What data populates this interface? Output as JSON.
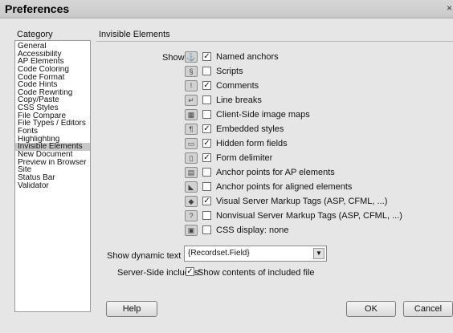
{
  "window": {
    "title": "Preferences",
    "close_glyph": "×"
  },
  "category": {
    "label": "Category",
    "items": [
      {
        "label": "General"
      },
      {
        "label": "Accessibility"
      },
      {
        "label": "AP Elements"
      },
      {
        "label": "Code Coloring"
      },
      {
        "label": "Code Format"
      },
      {
        "label": "Code Hints"
      },
      {
        "label": "Code Rewriting"
      },
      {
        "label": "Copy/Paste"
      },
      {
        "label": "CSS Styles"
      },
      {
        "label": "File Compare"
      },
      {
        "label": "File Types / Editors"
      },
      {
        "label": "Fonts"
      },
      {
        "label": "Highlighting"
      },
      {
        "label": "Invisible Elements",
        "selected": true
      },
      {
        "label": "New Document"
      },
      {
        "label": "Preview in Browser"
      },
      {
        "label": "Site"
      },
      {
        "label": "Status Bar"
      },
      {
        "label": "Validator"
      }
    ]
  },
  "section": {
    "title": "Invisible Elements",
    "show_label": "Show:",
    "options": [
      {
        "label": "Named anchors",
        "checked": true,
        "icon": "named-anchor-icon",
        "glyph": "⚓"
      },
      {
        "label": "Scripts",
        "checked": false,
        "icon": "script-icon",
        "glyph": "§"
      },
      {
        "label": "Comments",
        "checked": true,
        "icon": "comment-icon",
        "glyph": "!"
      },
      {
        "label": "Line breaks",
        "checked": false,
        "icon": "line-break-icon",
        "glyph": "↵"
      },
      {
        "label": "Client-Side image maps",
        "checked": false,
        "icon": "image-map-icon",
        "glyph": "▦"
      },
      {
        "label": "Embedded styles",
        "checked": true,
        "icon": "embedded-style-icon",
        "glyph": "¶"
      },
      {
        "label": "Hidden form fields",
        "checked": true,
        "icon": "hidden-field-icon",
        "glyph": "▭"
      },
      {
        "label": "Form delimiter",
        "checked": true,
        "icon": "form-delimiter-icon",
        "glyph": "▯"
      },
      {
        "label": "Anchor points for AP elements",
        "checked": false,
        "icon": "ap-anchor-icon",
        "glyph": "▤"
      },
      {
        "label": "Anchor points for aligned elements",
        "checked": false,
        "icon": "aligned-anchor-icon",
        "glyph": "◣"
      },
      {
        "label": "Visual Server Markup Tags (ASP, CFML, ...)",
        "checked": true,
        "icon": "visual-server-tag-icon",
        "glyph": "◆"
      },
      {
        "label": "Nonvisual Server Markup Tags (ASP, CFML, ...)",
        "checked": false,
        "icon": "nonvisual-server-tag-icon",
        "glyph": "?"
      },
      {
        "label": "CSS display: none",
        "checked": false,
        "icon": "css-display-none-icon",
        "glyph": "▣"
      }
    ],
    "dynamic_text_label": "Show dynamic text as:",
    "dynamic_text_value": "{Recordset.Field}",
    "ssi_label": "Server-Side includes:",
    "ssi_option": "Show contents of included file",
    "ssi_checked": true
  },
  "buttons": {
    "help": "Help",
    "ok": "OK",
    "cancel": "Cancel"
  },
  "check_glyph": "✓",
  "dropdown_glyph": "▼"
}
